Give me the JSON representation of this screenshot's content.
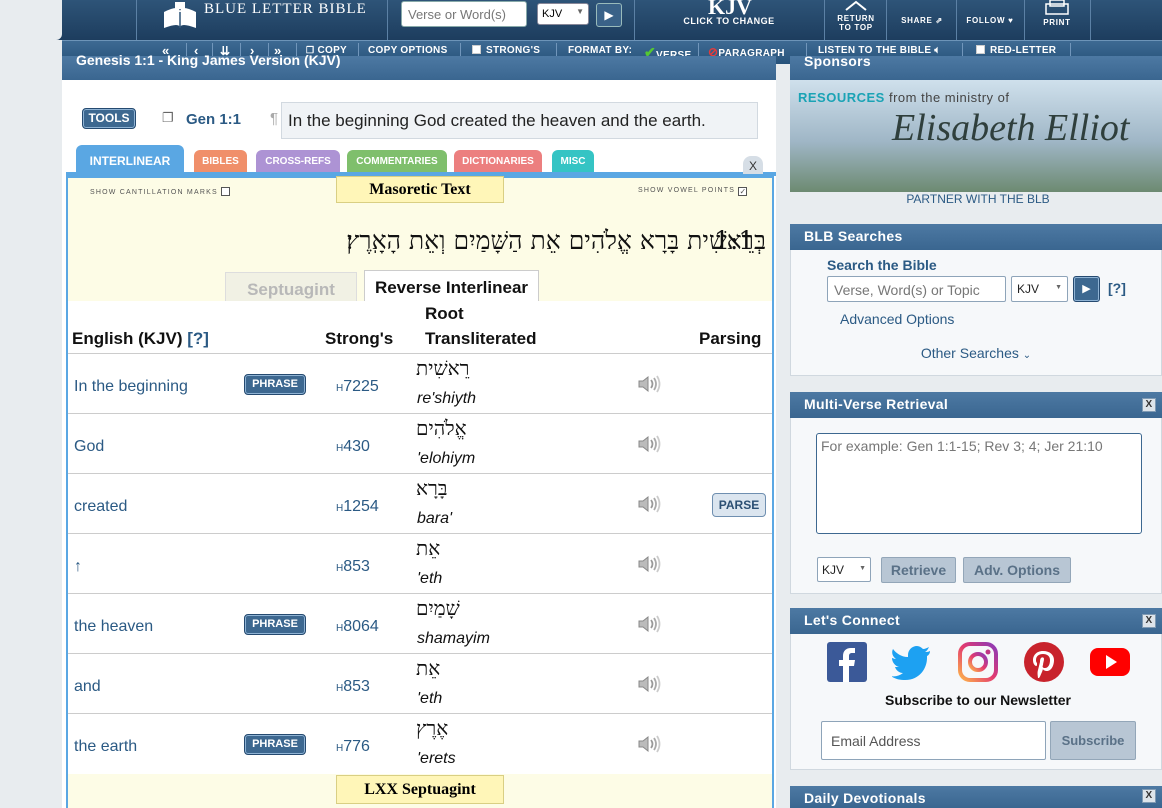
{
  "header": {
    "logo_text": "Blue Letter Bible",
    "search_placeholder": "Verse or Word(s)",
    "version_select": "KJV",
    "version_big": "KJV",
    "version_sub": "CLICK TO CHANGE",
    "return_top_label": "RETURN TO TOP",
    "share_label": "SHARE",
    "follow_label": "FOLLOW",
    "print_label": "PRINT"
  },
  "toolbar": {
    "copy": "COPY",
    "copy_options": "COPY OPTIONS",
    "strongs": "STRONG'S",
    "format_by": "FORMAT BY:",
    "verse": "VERSE",
    "paragraph": "PARAGRAPH",
    "listen": "LISTEN TO THE BIBLE",
    "red_letter": "RED-LETTER"
  },
  "main": {
    "title": "Genesis 1:1 - King James Version (KJV)",
    "tools_label": "TOOLS",
    "reference": "Gen 1:1",
    "verse_text": "In the beginning God created the heaven and the earth.",
    "tabs": [
      {
        "label": "INTERLINEAR",
        "color": "#5aa7e3"
      },
      {
        "label": "BIBLES",
        "color": "#f08f6a"
      },
      {
        "label": "CROSS-REFS",
        "color": "#ad93d4"
      },
      {
        "label": "COMMENTARIES",
        "color": "#7fbf6c"
      },
      {
        "label": "DICTIONARIES",
        "color": "#ec7f7f"
      },
      {
        "label": "MISC",
        "color": "#35c4c4"
      }
    ],
    "close_tab": "X"
  },
  "interlinear": {
    "section_title": "Masoretic Text",
    "cantillation_label": "SHOW CANTILLATION MARKS",
    "vowel_label": "SHOW VOWEL POINTS",
    "hebrew_verse": "בְּרֵאשִׁית בָּרָא אֱלֹהִים אֵת הַשָּׁמַיִם וְאֵת הָאָֽרֶץ׃",
    "verse_number": "1:1",
    "subtab_septuagint": "Septuagint",
    "subtab_reverse": "Reverse Interlinear",
    "col_english": "English (KJV)",
    "col_help": "[?]",
    "col_strongs": "Strong's",
    "col_root": "Root",
    "col_translit": "Transliterated",
    "col_parsing": "Parsing",
    "phrase_label": "PHRASE",
    "parse_label": "PARSE",
    "strongs_prefix": "H",
    "rows": [
      {
        "english": "In the beginning",
        "phrase": true,
        "strongs": "7225",
        "hebrew": "רֵאשִׁית",
        "translit": "re'shiyth",
        "parse": false
      },
      {
        "english": "God",
        "phrase": false,
        "strongs": "430",
        "hebrew": "אֱלֹהִים",
        "translit": "'elohiym",
        "parse": false
      },
      {
        "english": "created",
        "phrase": false,
        "strongs": "1254",
        "hebrew": "בָּרָא",
        "translit": "bara'",
        "parse": true
      },
      {
        "english": "↑",
        "phrase": false,
        "strongs": "853",
        "hebrew": "אֵת",
        "translit": "'eth",
        "parse": false
      },
      {
        "english": "the heaven",
        "phrase": true,
        "strongs": "8064",
        "hebrew": "שָׁמַיִם",
        "translit": "shamayim",
        "parse": false
      },
      {
        "english": "and",
        "phrase": false,
        "strongs": "853",
        "hebrew": "אֵת",
        "translit": "'eth",
        "parse": false
      },
      {
        "english": "the earth",
        "phrase": true,
        "strongs": "776",
        "hebrew": "אֶרֶץ",
        "translit": "'erets",
        "parse": false
      }
    ],
    "lxx_title": "LXX Septuagint"
  },
  "sidebar": {
    "sponsors_title": "Sponsors",
    "ad_resources": "RESOURCES",
    "ad_ministry": "from the ministry of",
    "ad_name": "Elisabeth Elliot",
    "partner": "PARTNER WITH THE BLB",
    "blb_searches_title": "BLB Searches",
    "search_bible_label": "Search the Bible",
    "search_placeholder": "Verse, Word(s) or Topic",
    "search_version": "KJV",
    "search_help": "[?]",
    "advanced_options": "Advanced Options",
    "other_searches": "Other Searches",
    "mvr_title": "Multi-Verse Retrieval",
    "mvr_placeholder": "For example: Gen 1:1-15; Rev 3; 4; Jer 21:10",
    "mvr_version": "KJV",
    "retrieve": "Retrieve",
    "adv_options": "Adv. Options",
    "connect_title": "Let's Connect",
    "newsletter_label": "Subscribe to our Newsletter",
    "email_placeholder": "Email Address",
    "subscribe": "Subscribe",
    "devotionals_title": "Daily Devotionals",
    "close": "X"
  }
}
